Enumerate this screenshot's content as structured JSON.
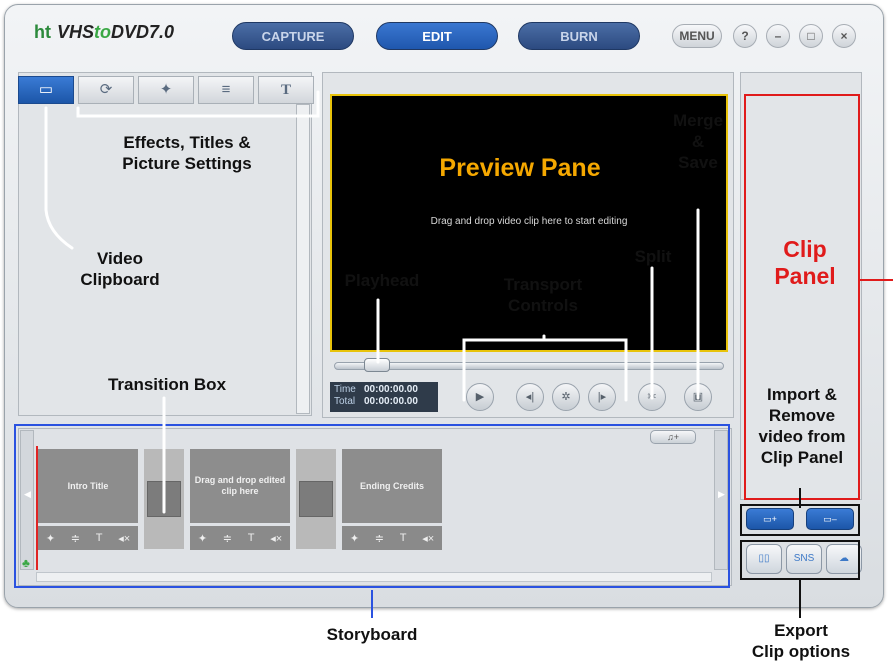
{
  "app": {
    "logo_prefix": "ht",
    "logo_a": "VHS",
    "logo_b": "to",
    "logo_c": "DVD",
    "logo_version": "7.0",
    "modes": [
      "CAPTURE",
      "EDIT",
      "BURN"
    ],
    "menu_label": "MENU",
    "help_label": "?",
    "minimize_label": "–",
    "maximize_label": "□",
    "close_label": "×"
  },
  "tabs": [
    {
      "icon": "film-strip-icon",
      "glyph": "▭"
    },
    {
      "icon": "swirl-effects-icon",
      "glyph": "⟳"
    },
    {
      "icon": "magic-wand-icon",
      "glyph": "✦"
    },
    {
      "icon": "sliders-icon",
      "glyph": "≡"
    },
    {
      "icon": "title-text-icon",
      "glyph": "T"
    }
  ],
  "preview": {
    "hint": "Drag and drop video clip here to start editing"
  },
  "time": {
    "time_label": "Time",
    "time_value": "00:00:00.00",
    "total_label": "Total",
    "total_value": "00:00:00.00"
  },
  "storyboard": {
    "clips": [
      "Intro Title",
      "Drag and drop edited clip here",
      "Ending Credits"
    ],
    "tool_glyphs": [
      "✦",
      "≑",
      "T",
      "◂×"
    ],
    "add_audio_label": "♫+"
  },
  "clip_panel": {
    "add_label": "▭+",
    "remove_label": "▭–",
    "export_sns_label": "SNS"
  },
  "callouts": {
    "effects": "Effects, Titles &\nPicture Settings",
    "clipboard": "Video\nClipboard",
    "preview_pane": "Preview Pane",
    "merge_save": "Merge\n&\nSave",
    "split": "Split",
    "playhead": "Playhead",
    "transport": "Transport\nControls",
    "transition": "Transition Box",
    "clip_panel": "Clip\nPanel",
    "import_remove": "Import &\nRemove\nvideo from\nClip Panel",
    "storyboard": "Storyboard",
    "export": "Export\nClip options"
  },
  "colors": {
    "callout_yellow": "#f5a800",
    "callout_red": "#e01b1b",
    "storyboard_blue": "#2a52e0",
    "preview_border": "#e8c30a",
    "accent_blue": "#1f57ad"
  }
}
